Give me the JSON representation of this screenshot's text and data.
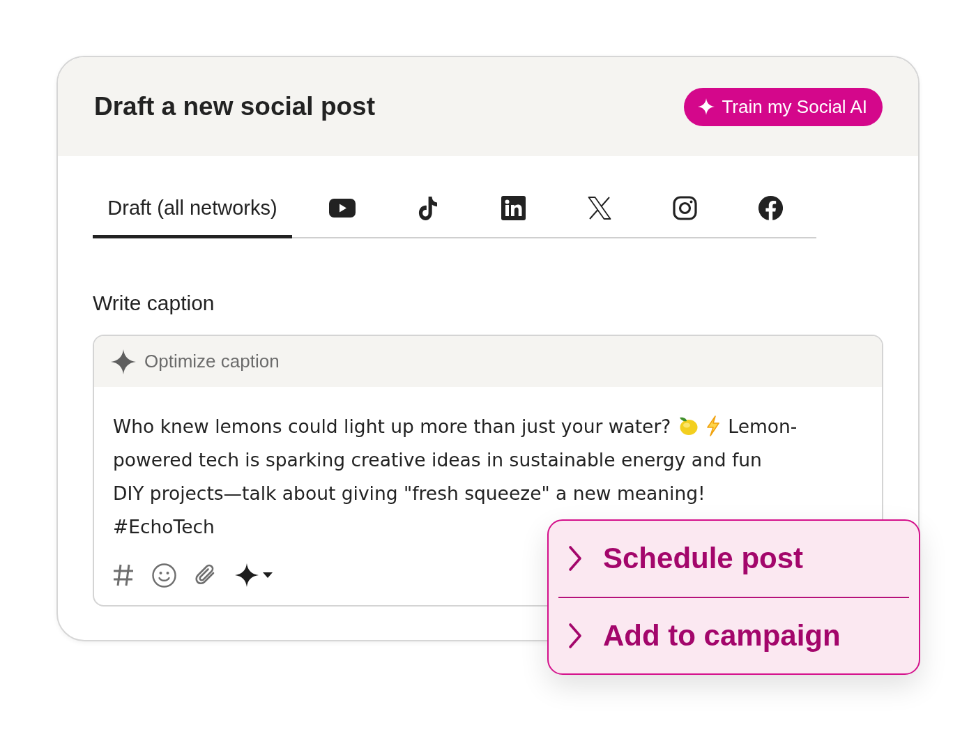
{
  "header": {
    "title": "Draft a new social post",
    "train_button": {
      "label": "Train my Social AI"
    }
  },
  "tabs": [
    {
      "kind": "text",
      "label": "Draft (all networks)",
      "selected": true
    },
    {
      "kind": "youtube",
      "selected": false
    },
    {
      "kind": "tiktok",
      "selected": false
    },
    {
      "kind": "linkedin",
      "selected": false
    },
    {
      "kind": "x",
      "selected": false
    },
    {
      "kind": "instagram",
      "selected": false
    },
    {
      "kind": "facebook",
      "selected": false
    }
  ],
  "caption": {
    "label": "Write caption",
    "optimize_button": {
      "label": "Optimize caption"
    },
    "lines": [
      {
        "parts": [
          {
            "kind": "text",
            "text": "Who knew lemons could light up more than just your water?"
          },
          {
            "kind": "lemon"
          },
          {
            "kind": "bolt"
          },
          {
            "kind": "text",
            "text": "Lemon-"
          }
        ]
      },
      {
        "parts": [
          {
            "kind": "text",
            "text": "powered tech is sparking creative ideas in sustainable energy and fun"
          }
        ]
      },
      {
        "parts": [
          {
            "kind": "text",
            "text": "DIY projects—talk about giving \"fresh squeeze\" a new meaning!"
          }
        ]
      },
      {
        "parts": [
          {
            "kind": "text",
            "text": "#EchoTech"
          }
        ]
      }
    ],
    "tools": [
      {
        "kind": "hashtag"
      },
      {
        "kind": "emoji"
      },
      {
        "kind": "attach"
      },
      {
        "kind": "ai"
      }
    ]
  },
  "menu": {
    "items": [
      {
        "label": "Schedule post"
      },
      {
        "label": "Add to campaign"
      }
    ]
  }
}
